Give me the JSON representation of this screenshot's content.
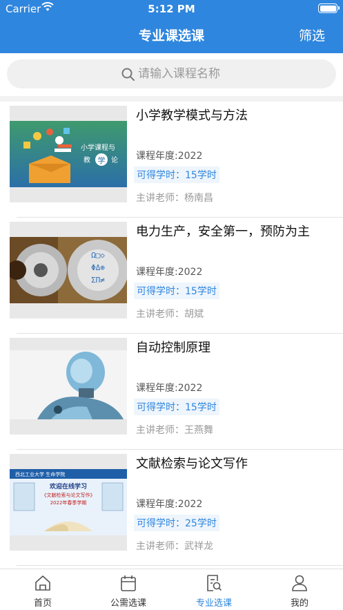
{
  "status": {
    "carrier": "Carrier",
    "time": "5:12 PM"
  },
  "nav": {
    "title": "专业课选课",
    "filter": "筛选"
  },
  "search": {
    "placeholder": "请输入课程名称"
  },
  "courses": [
    {
      "title": "小学教学模式与方法",
      "year": "课程年度:2022",
      "hours": "可得学时：15学时",
      "teacher": "主讲老师：杨南昌",
      "image": "education-illustration"
    },
    {
      "title": "电力生产，安全第一，预防为主",
      "year": "课程年度:2022",
      "hours": "可得学时：15学时",
      "teacher": "主讲老师：胡斌",
      "image": "gears-photo"
    },
    {
      "title": "自动控制原理",
      "year": "课程年度:2022",
      "hours": "可得学时：15学时",
      "teacher": "主讲老师：王燕舞",
      "image": "robot-photo"
    },
    {
      "title": "文献检索与论文写作",
      "year": "课程年度:2022",
      "hours": "可得学时：25学时",
      "teacher": "主讲老师：武祥龙",
      "image": "course-banner",
      "banner": {
        "school": "西北工业大学 生命学院",
        "welcome": "欢迎在线学习",
        "course": "《文献检索与论文写作》",
        "term": "2022年春季学期"
      }
    }
  ],
  "thumb1_text": "小学课程与教学论",
  "tabs": [
    {
      "label": "首页",
      "icon": "home-icon",
      "active": false
    },
    {
      "label": "公需选课",
      "icon": "calendar-icon",
      "active": false
    },
    {
      "label": "专业选课",
      "icon": "search-doc-icon",
      "active": true
    },
    {
      "label": "我的",
      "icon": "person-icon",
      "active": false
    }
  ],
  "colors": {
    "primary": "#2f86de",
    "background": "#f2f2f2"
  }
}
